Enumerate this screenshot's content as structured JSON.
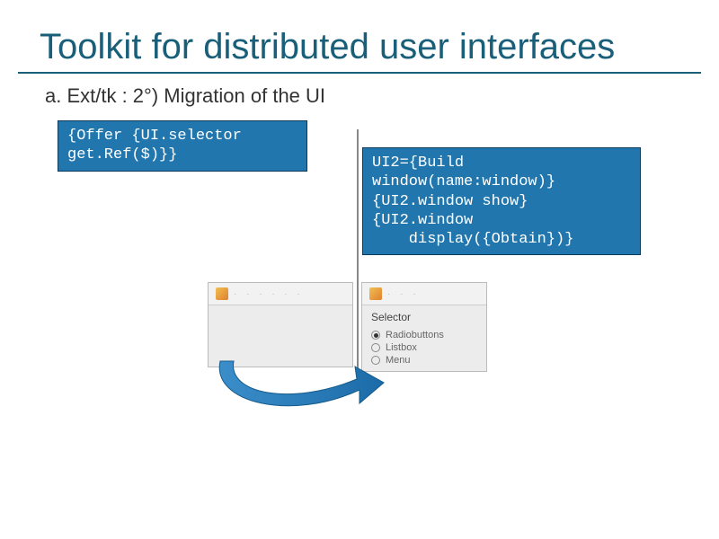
{
  "title": "Toolkit for distributed user interfaces",
  "subtitle": "a. Ext/tk : 2°) Migration of the UI",
  "code_left": "{Offer {UI.selector\nget.Ref($)}}",
  "code_right": "UI2={Build\nwindow(name:window)}\n{UI2.window show}\n{UI2.window\n    display({Obtain})}",
  "win_left": {
    "toolbar_dots": "· · · · · ·"
  },
  "win_right": {
    "selector_label": "Selector",
    "options": [
      "Radiobuttons",
      "Listbox",
      "Menu"
    ],
    "selected_index": 0
  }
}
